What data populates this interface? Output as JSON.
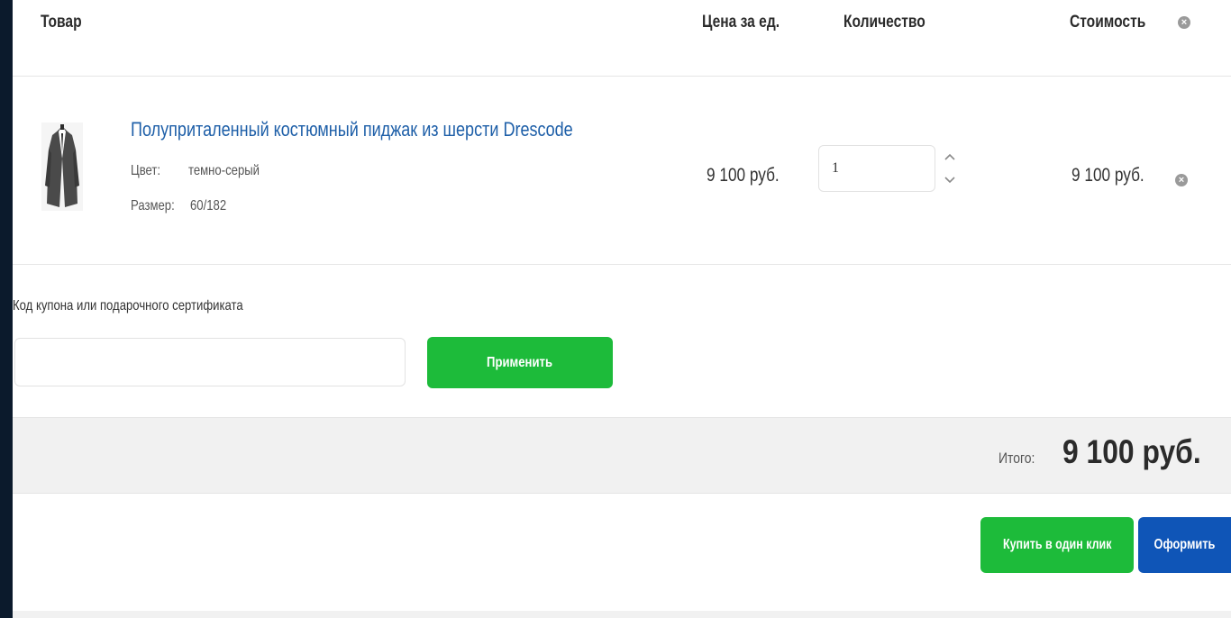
{
  "cart": {
    "headers": {
      "product": "Товар",
      "unit_price": "Цена за ед.",
      "quantity": "Количество",
      "cost": "Стоимость"
    },
    "items": [
      {
        "title": "Полуприталенный костюмный пиджак из шерсти Drescode",
        "color_label": "Цвет:",
        "color_value": "темно-серый",
        "size_label": "Размер:",
        "size_value": "60/182",
        "unit_price": "9 100 руб.",
        "quantity": "1",
        "cost": "9 100 руб."
      }
    ]
  },
  "coupon": {
    "label": "Код купона или подарочного сертификата",
    "value": "",
    "apply_label": "Применить"
  },
  "total": {
    "label": "Итого:",
    "value": "9 100 руб."
  },
  "actions": {
    "one_click_label": "Купить в один клик",
    "checkout_label": "Оформить"
  },
  "colors": {
    "link": "#1e5fa8",
    "green_button": "#1dbb3a",
    "blue_button": "#0f55b7",
    "background": "#0b1a2c"
  },
  "icons": {
    "remove": "close-circle-icon",
    "qty_up": "chevron-up-icon",
    "qty_down": "chevron-down-icon"
  }
}
